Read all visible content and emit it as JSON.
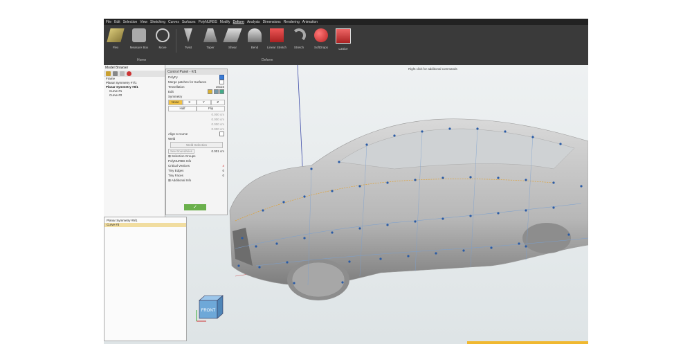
{
  "menu": [
    "File",
    "Edit",
    "Selection",
    "View",
    "Sketching",
    "Curves",
    "Surfaces",
    "PolyNURBS",
    "Modify",
    "Deform",
    "Analysis",
    "Dimensions",
    "Rendering",
    "Animation"
  ],
  "active_menu": "Deform",
  "toolbar": {
    "home_tools": [
      "Flex",
      "Measure Box",
      "Move"
    ],
    "deform_tools": [
      "Twist",
      "Taper",
      "Shear",
      "Bend",
      "Linear Stretch",
      "Stretch",
      "SoftDraps",
      "Lattice"
    ],
    "group_home": "Home",
    "group_deform": "Deform"
  },
  "viewport": {
    "hint": "Right click for additional commands",
    "cube_label": "FRONT"
  },
  "model_browser": {
    "title": "Model Browser",
    "items": [
      "Planar Symmetry #7/1",
      "Planar Symmetry #8/1",
      "Curve #1",
      "Curve #2"
    ],
    "root": "Frame"
  },
  "control_panel": {
    "title": "Control Panel - #/1",
    "polyfy": "PolyFy",
    "merge": "Merge patches for Surfaces",
    "tessellation": "Tessellation",
    "tessellation_value": "16x16",
    "edit": "Edit",
    "symmetry": "Symmetry",
    "sym_buttons": [
      "None",
      "X",
      "Y",
      "Z"
    ],
    "half": "Half",
    "flip": "Flip",
    "val1": "0.000 cm",
    "val2": "0.000 cm",
    "val3": "0.000 cm",
    "val4": "0.000 cm",
    "align": "Align to Curve",
    "weld": "Weld",
    "weld_selection": "Weld Selection",
    "see_boundaries": "See Boundaries",
    "val5": "0.001 cm",
    "selection_groups": "Selection Groups",
    "info_header": "PolyNURBS Info",
    "critical": "Critical Vertices",
    "critical_val": "4",
    "tiny_edges": "Tiny Edges",
    "tiny_edges_val": "0",
    "tiny_faces": "Tiny Faces",
    "tiny_faces_val": "0",
    "additional": "Additional Info",
    "ok": "✓"
  },
  "lower_panel": {
    "items": [
      "Planar Symmetry #9/1",
      "Curve #3"
    ]
  }
}
